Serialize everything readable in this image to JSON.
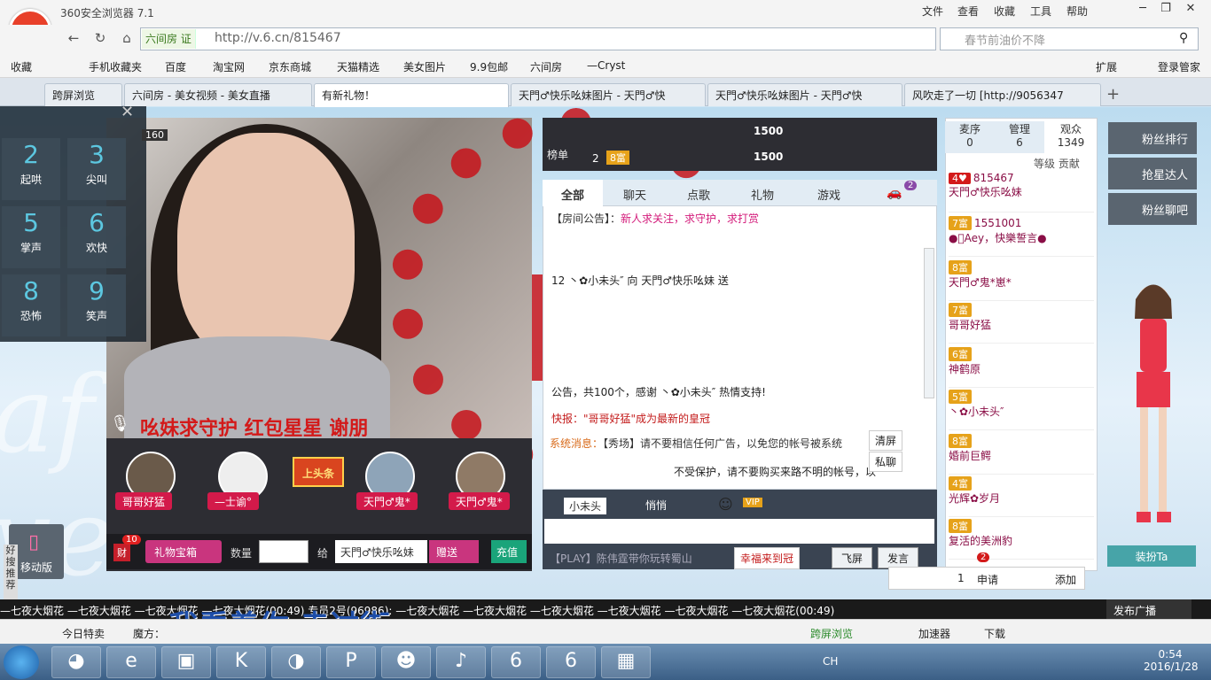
{
  "browser": {
    "title": "360安全浏览器 7.1",
    "logo": "NEW",
    "menus": [
      "文件",
      "查看",
      "收藏",
      "工具",
      "帮助"
    ],
    "cert": "六间房 证",
    "url": "http://v.6.cn/815467",
    "search_placeholder": "春节前油价不降",
    "bookmarks": [
      "收藏",
      "手机收藏夹",
      "百度",
      "淘宝网",
      "京东商城",
      "天猫精选",
      "美女图片",
      "9.9包邮",
      "六间房",
      "—Cryst"
    ],
    "bm_right": [
      "扩展",
      "登录管家"
    ],
    "tabs": [
      {
        "label": "跨屏浏览"
      },
      {
        "label": "六间房 - 美女视频 - 美女直播"
      },
      {
        "label": "有新礼物！"
      },
      {
        "label": "天門♂快乐吆妹图片 - 天門♂快"
      },
      {
        "label": "天門♂快乐吆妹图片 - 天門♂快"
      },
      {
        "label": "风吹走了一切 [http://9056347"
      }
    ]
  },
  "pad": {
    "count": "160",
    "keys": [
      {
        "n": "2",
        "l": "起哄"
      },
      {
        "n": "3",
        "l": "尖叫"
      },
      {
        "n": "5",
        "l": "掌声"
      },
      {
        "n": "6",
        "l": "欢快"
      },
      {
        "n": "8",
        "l": "恐怖"
      },
      {
        "n": "9",
        "l": "笑声"
      }
    ]
  },
  "video": {
    "banner": "吆妹求守护    红包星星          谢朋"
  },
  "mobile": "移动版",
  "goodsearch": "好搜推荐",
  "gifts": {
    "items": [
      "哥哥好猛",
      "—士谕°",
      "上头条",
      "天門♂鬼*",
      "天門♂鬼*"
    ],
    "box_count": "10",
    "box_label": "财",
    "treasure": "礼物宝箱",
    "qty_label": "数量",
    "give_label": "给",
    "give_to": "天門♂快乐吆妹",
    "give_btn": "赠送",
    "recharge": "充值"
  },
  "rank": {
    "label": "榜单",
    "num": "2",
    "score1": "1500",
    "score2": "1500",
    "level": "8富"
  },
  "chat": {
    "tabs": [
      "全部",
      "聊天",
      "点歌",
      "礼物",
      "游戏"
    ],
    "car_count": "2",
    "notice_label": "【房间公告】：",
    "notice": "新人求关注，求守护，求打赏",
    "line1": "12 丶✿小未头″ 向 天門♂快乐吆妹 送",
    "line2": "公告，共100个，感谢 丶✿小未头″ 热情支持!",
    "line3": "快报：\"哥哥好猛\"成为最新的皇冠",
    "sys_label": "系统消息：",
    "sys": "【秀场】请不要相信任何广告，以免您的帐号被系统",
    "sys2": "不受保护，请不要购买来路不明的帐号，以",
    "clear": "清屏",
    "private": "私聊",
    "whisper": "悄悄",
    "target": "小未头",
    "play": "【PLAY】陈伟霆带你玩转蜀山",
    "crown": "幸福来到冠",
    "fly": "飞屏",
    "send": "发言"
  },
  "users": {
    "tabs": [
      {
        "l": "麦序",
        "c": "0"
      },
      {
        "l": "管理",
        "c": "6"
      },
      {
        "l": "观众",
        "c": "1349"
      }
    ],
    "header": "等级 贡献",
    "rows": [
      {
        "badge": "4♥",
        "name": "815467",
        "sub": "天門♂快乐吆妹"
      },
      {
        "badge": "7富",
        "name": "1551001",
        "sub": "●ฺAey，快樂誓言●"
      },
      {
        "badge": "8富",
        "name": "天門♂鬼*崽*",
        "sub": ""
      },
      {
        "badge": "7富",
        "name": "哥哥好猛",
        "sub": ""
      },
      {
        "badge": "6富",
        "name": "神鹤原",
        "sub": ""
      },
      {
        "badge": "5富",
        "name": "丶✿小未头″",
        "sub": ""
      },
      {
        "badge": "8富",
        "name": "婚前巨鳄",
        "sub": ""
      },
      {
        "badge": "4富",
        "name": "光辉✿岁月",
        "sub": ""
      },
      {
        "badge": "8富",
        "name": "复活的美洲豹",
        "sub": ""
      }
    ],
    "apply_count": "2",
    "apply_num": "1",
    "apply": "申请",
    "add": "添加"
  },
  "side": {
    "btns": [
      "粉丝排行",
      "抢星达人",
      "粉丝聊吧"
    ],
    "dress": "装扮Ta"
  },
  "ticker": {
    "text": "—七夜大烟花    —七夜大烟花   —七夜大烟花   —七夜大烟花(00:49)   专员2号(96986): —七夜大烟花   —七夜大烟花   —七夜大烟花   —七夜大烟花   —七夜大烟花   —七夜大烟花(00:49)",
    "lyrics": "我看着你 走过街",
    "broadcast": "发布广播"
  },
  "status": {
    "left": [
      "今日特卖",
      "魔方："
    ],
    "right": [
      "跨屏浏览",
      "加速器",
      "下载"
    ]
  },
  "taskbar": {
    "time": "0:54",
    "date": "2016/1/28",
    "lang": "CH"
  }
}
